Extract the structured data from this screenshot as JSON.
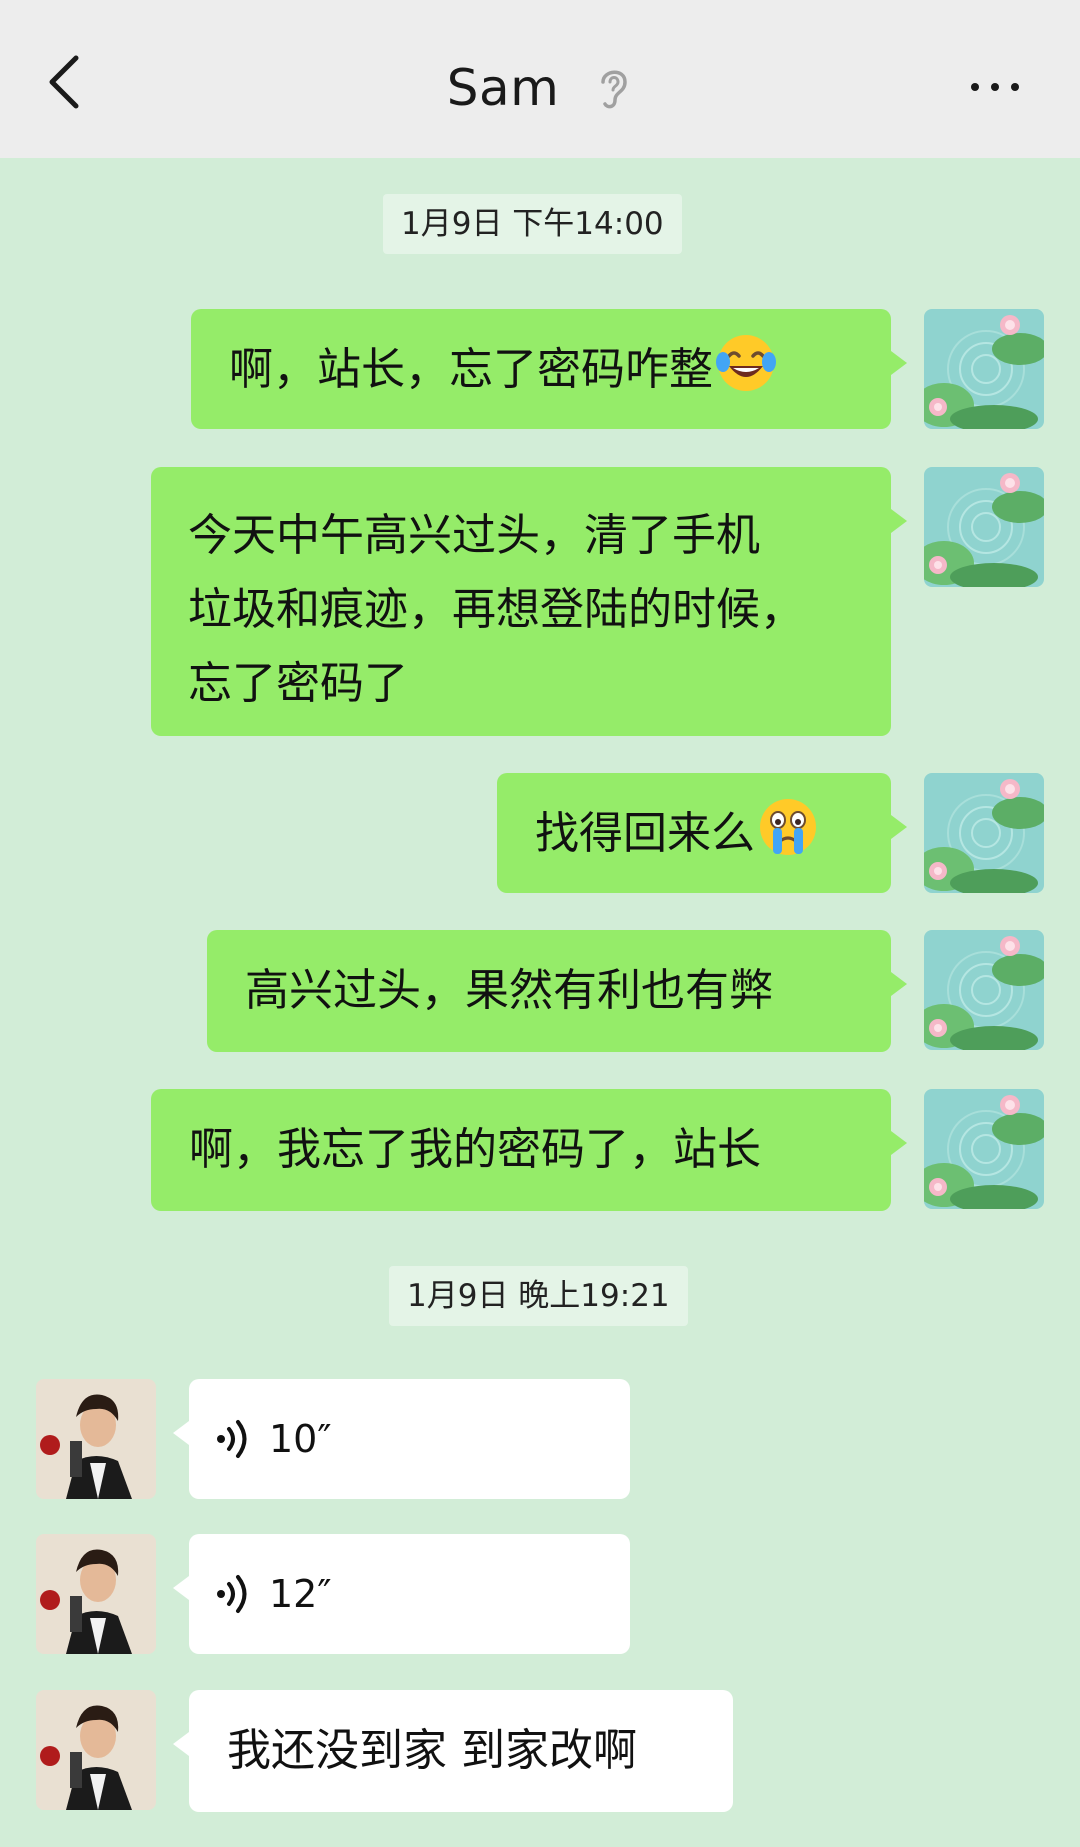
{
  "header": {
    "title": "Sam",
    "back_icon": "chevron-left-icon",
    "mode_icon": "ear-icon",
    "more_icon": "more-icon"
  },
  "timestamps": [
    "1月9日 下午14:00",
    "1月9日 晚上19:21"
  ],
  "outgoing_messages": [
    {
      "text": "啊，站长，忘了密码咋整",
      "emoji": "tears-of-joy"
    },
    {
      "lines": [
        "今天中午高兴过头，清了手机",
        "垃圾和痕迹，再想登陆的时候，",
        "忘了密码了"
      ]
    },
    {
      "text": "找得回来么",
      "emoji": "crying-face"
    },
    {
      "text": "高兴过头，果然有利也有弊"
    },
    {
      "text": "啊，我忘了我的密码了，站长"
    }
  ],
  "incoming_messages": [
    {
      "type": "voice",
      "duration": "10″"
    },
    {
      "type": "voice",
      "duration": "12″"
    },
    {
      "type": "text",
      "text": "我还没到家 到家改啊"
    }
  ],
  "colors": {
    "background": "#d2edd7",
    "header": "#ededed",
    "outgoing_bubble": "#95ec69",
    "incoming_bubble": "#ffffff"
  }
}
